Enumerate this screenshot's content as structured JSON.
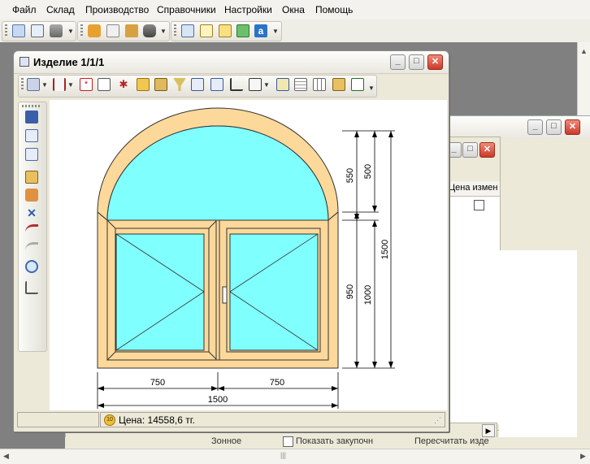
{
  "menu": [
    "Файл",
    "Склад",
    "Производство",
    "Справочники",
    "Настройки",
    "Окна",
    "Помощь"
  ],
  "child_window": {
    "title": "Изделие 1/1/1",
    "status_price": "Цена: 14558,6 тг.",
    "price_icon_text": "10"
  },
  "background": {
    "col_header": "Цена измен",
    "bottom_text1": "Зонное",
    "bottom_text2": "Показать закупочн",
    "bottom_text3": "Пересчитать изде"
  },
  "drawing": {
    "dims": {
      "right_top_outer": "550",
      "right_top_inner": "500",
      "right_mid_outer": "950",
      "right_mid_inner": "1000",
      "right_total": "1500",
      "bottom_left": "750",
      "bottom_right": "750",
      "bottom_total": "1500"
    }
  },
  "colors": {
    "frame": "#fcd89a",
    "glass": "#80ffff",
    "stroke": "#333333",
    "dim_line": "#000000"
  },
  "icons": {
    "main_toolbar": [
      "grid-icon",
      "window-icon",
      "printer-icon",
      "box-icon",
      "copy-icon",
      "package-icon",
      "truck-icon",
      "table-icon",
      "pages-icon",
      "document-icon",
      "export-icon",
      "calc-icon"
    ],
    "inner_toolbar": [
      "frame-icon",
      "mullion-icon",
      "delete-icon",
      "panel-icon",
      "cross-icon",
      "fill-icon",
      "layout-icon",
      "filter-icon",
      "split-v-icon",
      "split-h-icon",
      "impost-icon",
      "align-icon",
      "insert-icon",
      "table-icon",
      "grid-icon",
      "edit-icon",
      "save-edit-icon"
    ],
    "side_toolbar": [
      "save-icon",
      "frame-icon",
      "split-icon",
      "edit-icon",
      "palette-icon",
      "resize-icon",
      "curve-icon",
      "curve2-icon",
      "zoom-icon",
      "measure-icon"
    ]
  }
}
